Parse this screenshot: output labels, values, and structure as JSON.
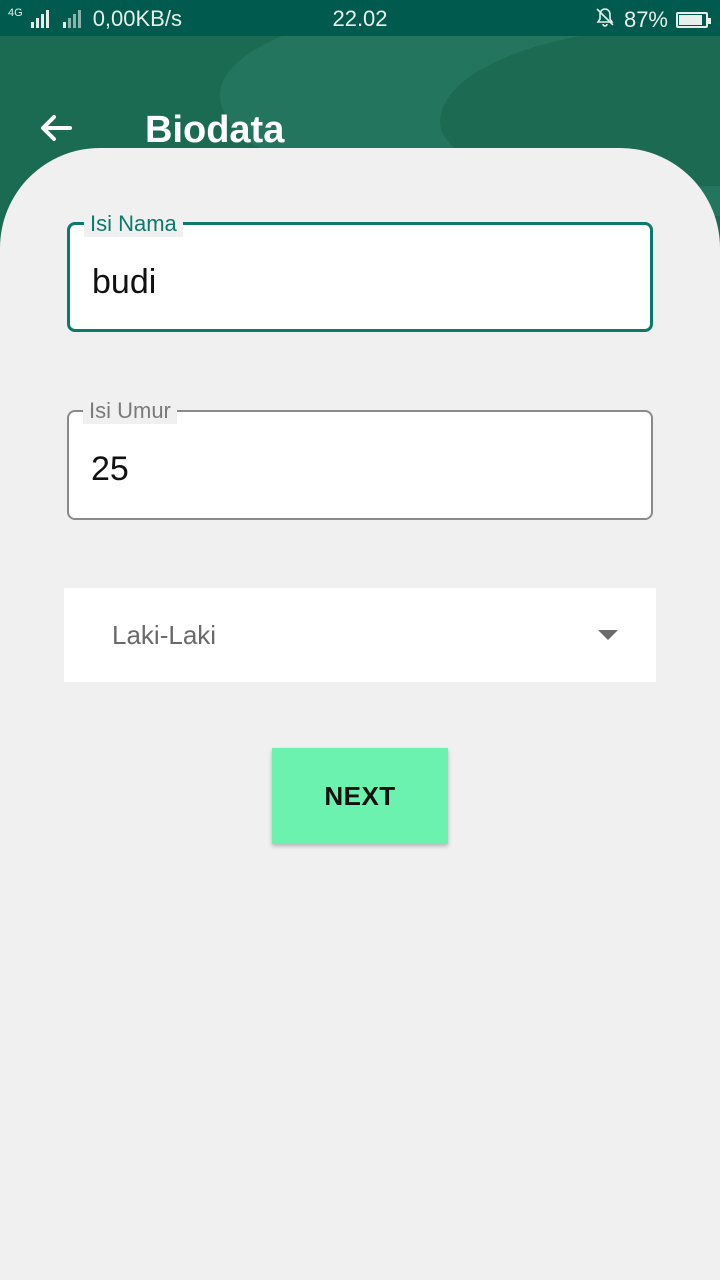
{
  "status_bar": {
    "network_speed": "0,00KB/s",
    "network_type": "4G",
    "time": "22.02",
    "battery": "87%",
    "battery_level": 0.87,
    "icons": [
      "signal-icon",
      "signal-icon",
      "mute-bell-icon",
      "battery-icon"
    ]
  },
  "app_bar": {
    "title": "Biodata",
    "back_icon": "arrow-left-icon"
  },
  "form": {
    "nama": {
      "label": "Isi Nama",
      "value": "budi"
    },
    "umur": {
      "label": "Isi Umur",
      "value": "25"
    },
    "gender": {
      "selected": "Laki-Laki"
    },
    "next_label": "NEXT"
  },
  "colors": {
    "header": "#1b6a52",
    "status_bar": "#005a4e",
    "focus_accent": "#0b7a6c",
    "button": "#6bf2ae",
    "background": "#f0f0f0"
  }
}
